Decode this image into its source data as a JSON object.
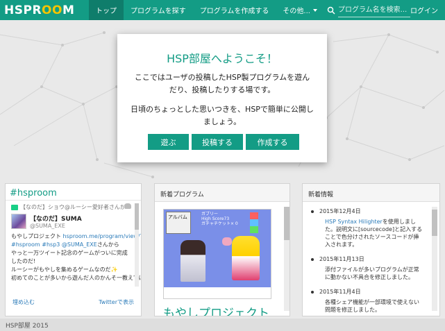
{
  "brand": {
    "part1": "HSP ",
    "part2": "R",
    "part3": "OO",
    "part4": "M"
  },
  "nav": {
    "items": [
      {
        "label": "トップ"
      },
      {
        "label": "プログラムを探す"
      },
      {
        "label": "プログラムを作成する"
      },
      {
        "label": "その他..."
      }
    ],
    "search_placeholder": "プログラム名を検索...",
    "login": "ログイン"
  },
  "welcome": {
    "title": "HSP部屋へようこそ！",
    "para1_line1": "ここではユーザの投稿したHSP製プログラムを遊ん",
    "para1_line2": "だり、投稿したりする場です。",
    "para2_line1": "日頃のちょっとした思いつきを、HSPで簡単に公開し",
    "para2_line2": "ましょう。",
    "buttons": [
      "遊ぶ",
      "投稿する",
      "作成する"
    ]
  },
  "twitter": {
    "title": "#hsproom",
    "retweet": "【なのだ】ショウ@ルーシー愛好者さんがリツイートしました",
    "user_name": "【なのだ】SUMA",
    "user_handle": "@SUMA_EXE",
    "text": [
      {
        "a": "もやしプロジェクト ",
        "b": "hsproom.me/program/view/?..."
      },
      {
        "a": "",
        "b": "#hsproom #hsp3 @SUMA_EXE",
        "c": "さんから"
      },
      {
        "a": "やっと一万ツイート記念のゲームがついに完成したのだ!"
      },
      {
        "a": "ルーシーがもやしを集めるゲームなのだ✨"
      },
      {
        "a": "初めてのことが多いから遊んだ人のかんそ一教えてほし"
      }
    ],
    "load_more": "埋め込む",
    "view_on_twitter": "Twitterで表示"
  },
  "new_programs": {
    "header": "新着プログラム",
    "album": "アルバム",
    "hud_line1": "ガブリー",
    "hud_line2": "High Score73",
    "hud_line3": "ガチャチケット× 0",
    "title": "もやしプロジェクト"
  },
  "news": {
    "header": "新着情報",
    "items": [
      {
        "date": "2015年12月4日",
        "link": "HSP Syntax Hilighter",
        "desc": "を使用しました。説明文に[sourcecode]と記入することで色分けされたソースコードが挿入されます。"
      },
      {
        "date": "2015年11月13日",
        "link": "",
        "desc": "添付ファイルが多いプログラムが正常に動かない不具合を修正しました。"
      },
      {
        "date": "2015年11月4日",
        "link": "",
        "desc": "各種シェア機能が一部環境で使えない問題を修正しました。"
      }
    ]
  },
  "footer": "HSP部屋 2015"
}
